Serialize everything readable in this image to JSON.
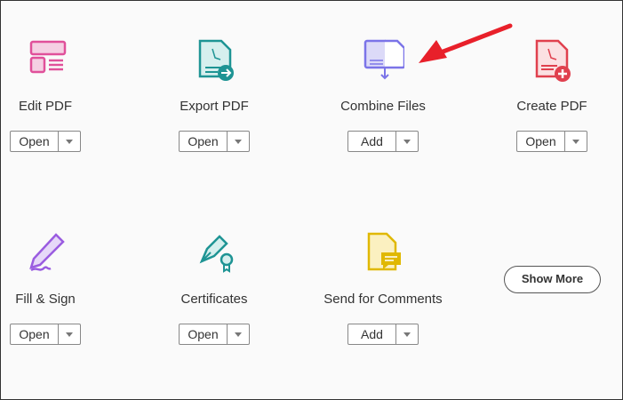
{
  "tools": [
    {
      "label": "Edit PDF",
      "button": "Open",
      "icon": "edit-pdf-icon",
      "color": "#e0509a"
    },
    {
      "label": "Export PDF",
      "button": "Open",
      "icon": "export-pdf-icon",
      "color": "#1e9494"
    },
    {
      "label": "Combine Files",
      "button": "Add",
      "icon": "combine-files-icon",
      "color": "#7b74e8"
    },
    {
      "label": "Create PDF",
      "button": "Open",
      "icon": "create-pdf-icon",
      "color": "#e0404e"
    },
    {
      "label": "Fill & Sign",
      "button": "Open",
      "icon": "fill-sign-icon",
      "color": "#9a5ce0"
    },
    {
      "label": "Certificates",
      "button": "Open",
      "icon": "certificates-icon",
      "color": "#1e9494"
    },
    {
      "label": "Send for Comments",
      "button": "Add",
      "icon": "send-comments-icon",
      "color": "#e0b800"
    }
  ],
  "show_more": "Show More",
  "annotation_color": "#e8202a"
}
